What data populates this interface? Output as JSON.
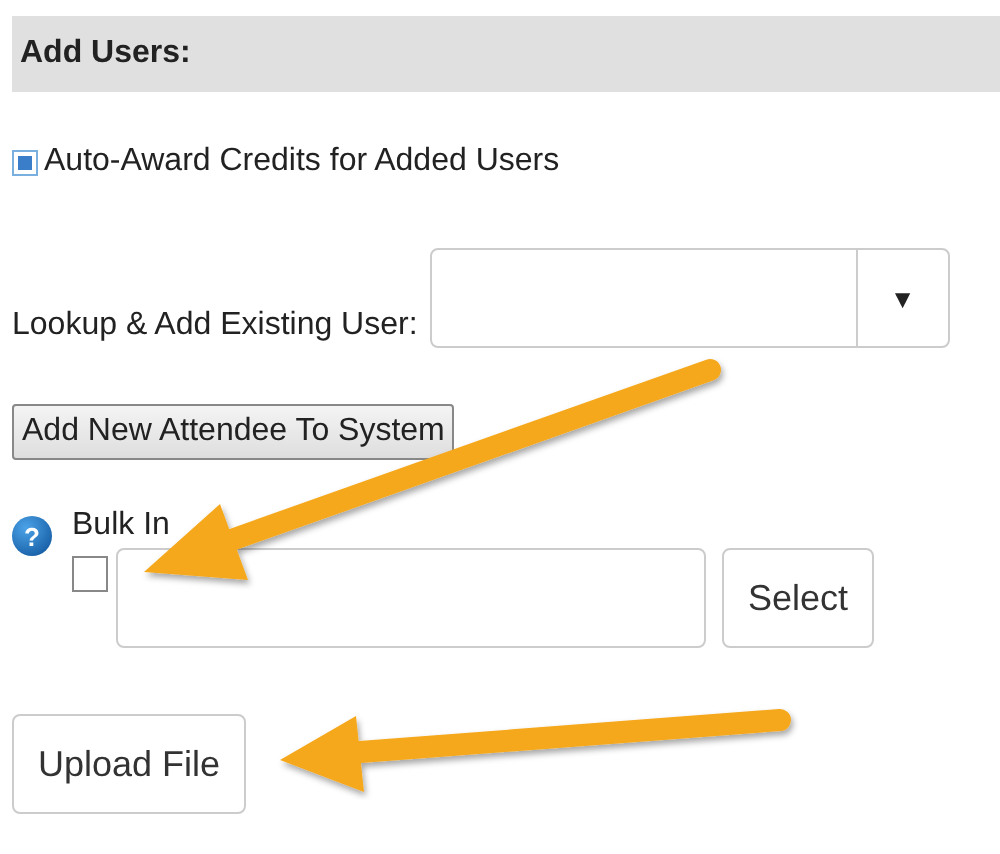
{
  "section": {
    "title": "Add Users:"
  },
  "auto_award": {
    "label": "Auto-Award Credits for Added Users",
    "checked": true
  },
  "lookup": {
    "label": "Lookup & Add Existing User:",
    "caret": "▼"
  },
  "add_attendee": {
    "label": "Add New Attendee To System"
  },
  "bulk_import": {
    "label": "Bulk In",
    "help": "?",
    "checked": false,
    "select": "Select"
  },
  "upload": {
    "label": "Upload File"
  }
}
